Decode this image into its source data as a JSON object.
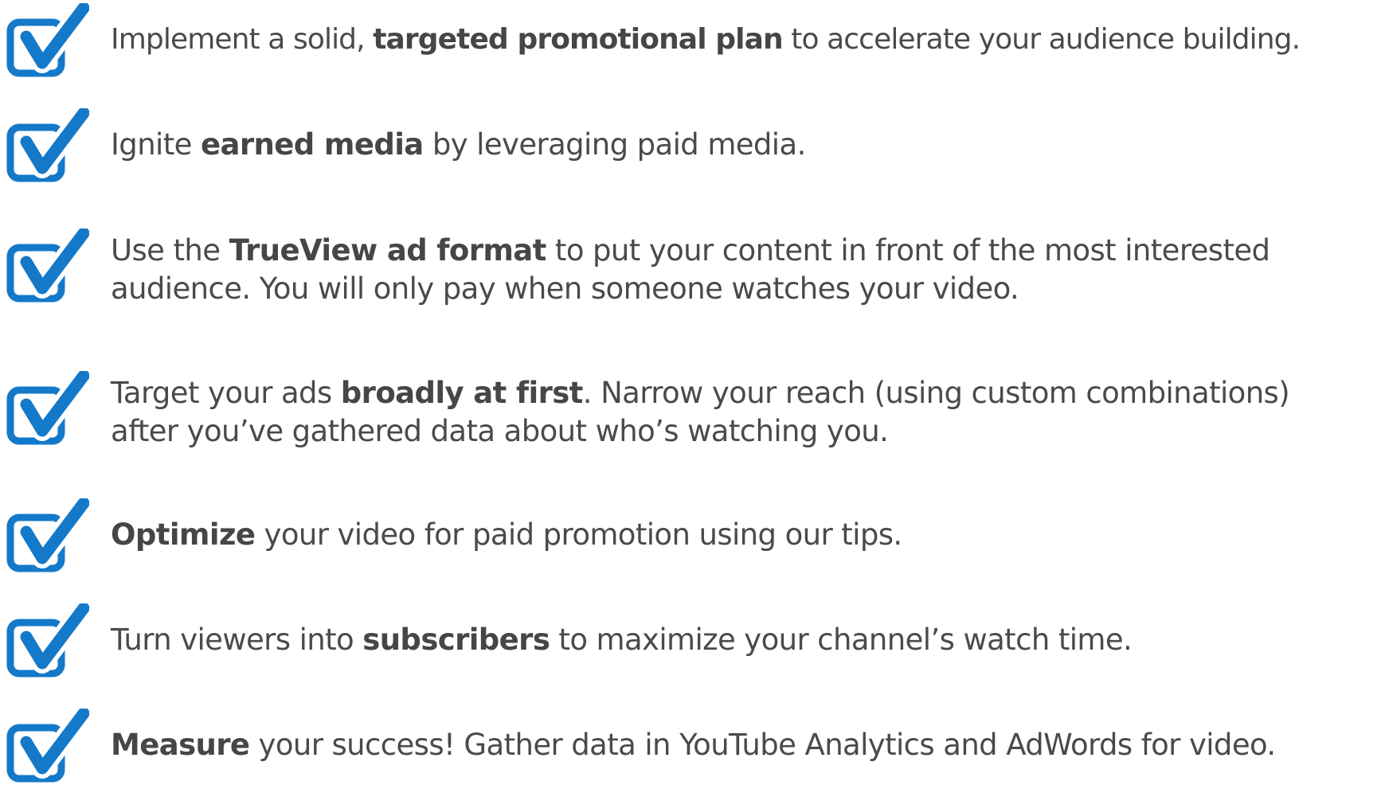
{
  "colors": {
    "accent": "#1479c9",
    "text": "#4a4a4a"
  },
  "icon": "checked-box-icon",
  "items": [
    {
      "before": "Implement a solid, ",
      "bold": "targeted promotional plan",
      "after": " to accelerate your audience building.",
      "line2": ""
    },
    {
      "before": "Ignite ",
      "bold": "earned media",
      "after": " by leveraging paid media.",
      "line2": ""
    },
    {
      "before": "Use the ",
      "bold": "TrueView ad format",
      "after": " to put your content in front of the most interested",
      "line2": "audience. You will only pay when someone watches your video."
    },
    {
      "before": "Target your ads ",
      "bold": "broadly at first",
      "after": ". Narrow your reach (using custom combinations)",
      "line2": "after you’ve gathered data about who’s watching you."
    },
    {
      "before": "",
      "bold": "Optimize",
      "after": " your video for paid promotion using our tips.",
      "line2": ""
    },
    {
      "before": "Turn viewers into ",
      "bold": "subscribers",
      "after": " to maximize your channel’s watch time.",
      "line2": ""
    },
    {
      "before": "",
      "bold": "Measure",
      "after": " your success! Gather data in YouTube Analytics and AdWords for video.",
      "line2": ""
    }
  ]
}
